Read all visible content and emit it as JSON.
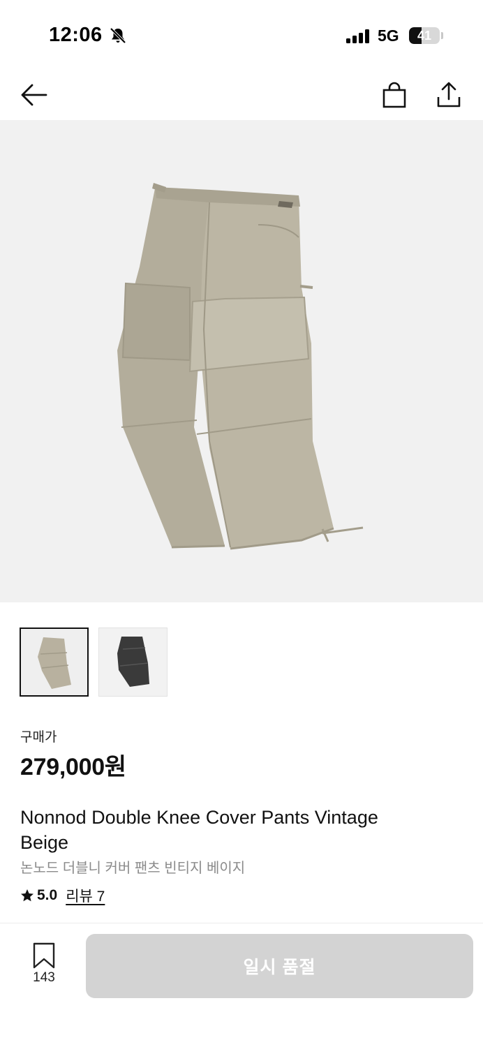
{
  "status_bar": {
    "time": "12:06",
    "network": "5G",
    "battery_level": "41",
    "battery_fraction": 0.41,
    "icons": [
      "bell-slash-icon",
      "signal-icon",
      "battery-icon"
    ]
  },
  "nav": {
    "icons": [
      "arrow-left-icon",
      "shopping-bag-icon",
      "share-icon"
    ]
  },
  "product": {
    "price_label": "구매가",
    "price": "279,000원",
    "name_en": "Nonnod Double Knee Cover Pants Vintage Beige",
    "name_ko": "논노드 더블니 커버 팬츠 빈티지 베이지",
    "rating": "5.0",
    "review_label": "리뷰 7",
    "thumbnails": [
      "vintage-beige",
      "black"
    ]
  },
  "bottom_bar": {
    "bookmark_count": "143",
    "action_label": "일시 품절"
  },
  "colors": {
    "image_background": "#f1f1f1",
    "pants_beige": "#b8b19f",
    "pants_black": "#3a3a3a",
    "disabled_button": "#d3d3d3"
  }
}
